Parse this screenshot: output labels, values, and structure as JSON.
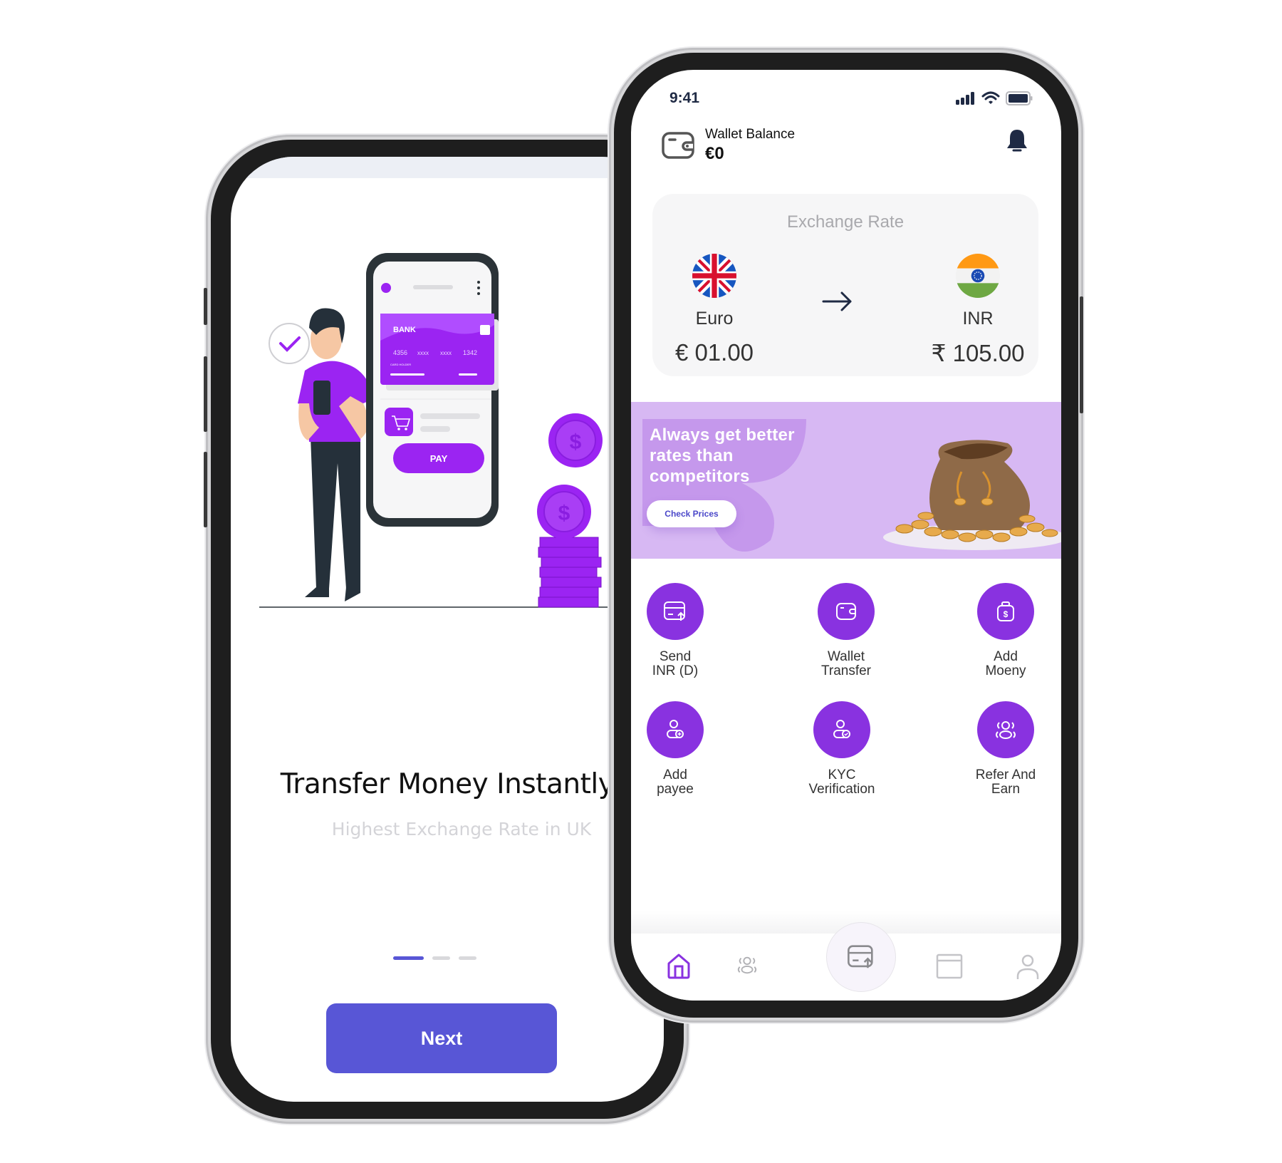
{
  "onboarding": {
    "title": "Transfer Money Instantly",
    "subtitle": "Highest Exchange Rate in UK",
    "pagination": {
      "total": 3,
      "active": 1
    },
    "next_label": "Next",
    "illustration": {
      "card_brand": "BANK",
      "card_number": [
        "4356",
        "xxxx",
        "xxxx",
        "1342"
      ],
      "card_holder_label": "CARD HOLDER",
      "pay_label": "PAY",
      "coin_symbol": "$"
    }
  },
  "home": {
    "status_bar": {
      "time": "9:41"
    },
    "wallet": {
      "label": "Wallet Balance",
      "value": "€0"
    },
    "exchange": {
      "title": "Exchange Rate",
      "from": {
        "name": "Euro",
        "amount": "€ 01.00",
        "flag": "uk-flag"
      },
      "to": {
        "name": "INR",
        "amount": "₹ 105.00",
        "flag": "india-flag"
      }
    },
    "promo": {
      "lines": [
        "Always get better",
        "rates than",
        "competitors"
      ],
      "button_label": "Check Prices"
    },
    "actions": [
      {
        "label_1": "Send",
        "label_2": "INR (D)",
        "icon": "card-send-icon"
      },
      {
        "label_1": "Wallet",
        "label_2": "Transfer",
        "icon": "wallet-icon"
      },
      {
        "label_1": "Add",
        "label_2": "Moeny",
        "icon": "money-bag-icon"
      },
      {
        "label_1": "Add",
        "label_2": "payee",
        "icon": "add-user-icon"
      },
      {
        "label_1": "KYC",
        "label_2": "Verification",
        "icon": "verified-user-icon"
      },
      {
        "label_1": "Refer And",
        "label_2": "Earn",
        "icon": "users-group-icon"
      }
    ],
    "tabbar": [
      "home",
      "community",
      "send",
      "cards",
      "profile"
    ],
    "colors": {
      "accent": "#8932e0",
      "primary": "#5856d6",
      "promo_bg": "#d7b8f3"
    }
  }
}
